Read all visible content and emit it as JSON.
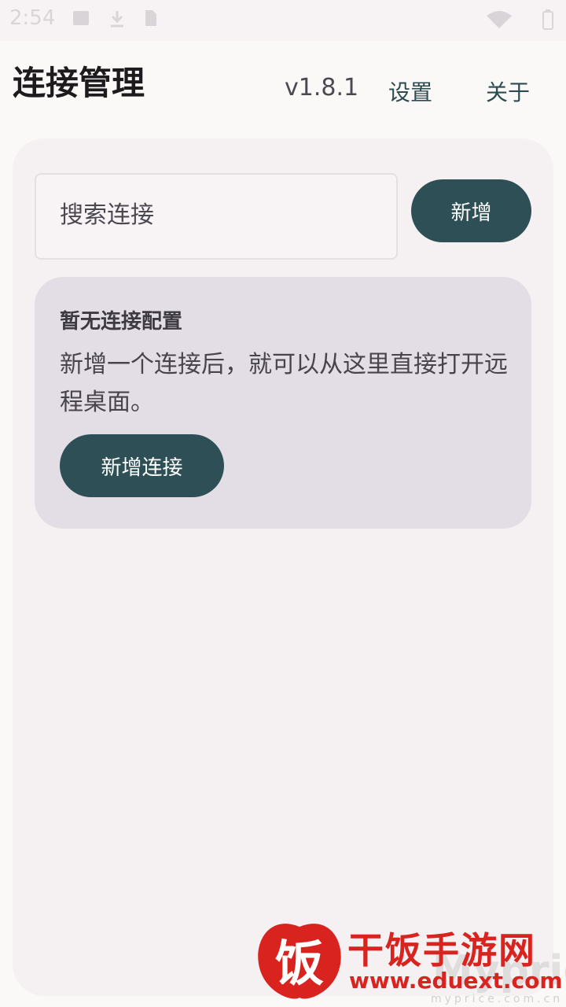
{
  "status_bar": {
    "time": "2:54",
    "icons": [
      "image-icon",
      "download-icon",
      "sim-icon",
      "wifi-icon",
      "battery-icon"
    ]
  },
  "header": {
    "title": "连接管理",
    "version": "v1.8.1",
    "settings_label": "设置",
    "about_label": "关于"
  },
  "search": {
    "placeholder": "搜索连接",
    "value": ""
  },
  "toolbar": {
    "add_label": "新增"
  },
  "empty_state": {
    "title": "暂无连接配置",
    "description": "新增一个连接后，就可以从这里直接打开远程桌面。",
    "add_connection_label": "新增连接"
  },
  "watermark": {
    "logo_char": "饭",
    "name": "干饭手游网",
    "url": "www.eduext.com",
    "faint_text": "Myprice",
    "faint_url": "myprice.com.cn"
  },
  "colors": {
    "accent": "#2e4f55",
    "background": "#fbf9f7",
    "card": "#e3dee6",
    "watermark_red": "#d8231f"
  }
}
